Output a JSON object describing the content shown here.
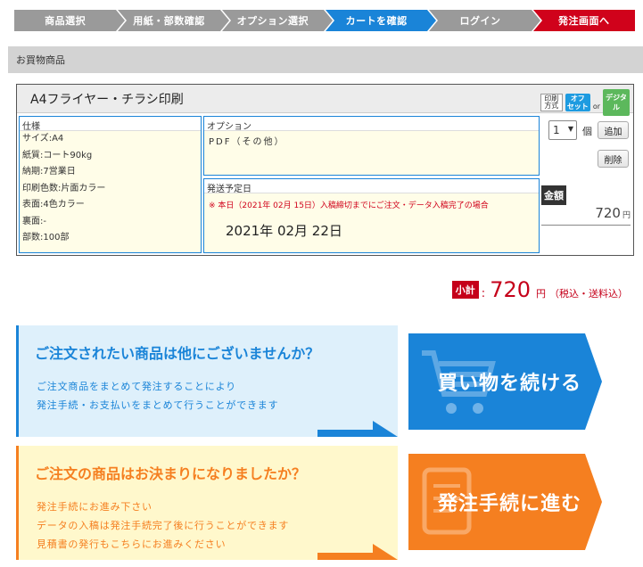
{
  "steps": [
    {
      "label": "商品選択",
      "state": "done"
    },
    {
      "label": "用紙・部数確認",
      "state": "done"
    },
    {
      "label": "オプション選択",
      "state": "done"
    },
    {
      "label": "カートを確認",
      "state": "current"
    },
    {
      "label": "ログイン",
      "state": "todo"
    },
    {
      "label": "発注画面へ",
      "state": "order"
    }
  ],
  "section_title": "お買物商品",
  "product": {
    "name": "A4フライヤー・チラシ印刷",
    "method_label": "印刷\n方式",
    "method_offset": "オフ\nセット",
    "method_or": "or",
    "method_digital": "デジタル",
    "spec_label": "仕様",
    "spec_lines": [
      "サイズ:A4",
      "紙質:コート90kg",
      "納期:7営業日",
      "印刷色数:片面カラー",
      "表面:4色カラー",
      "裏面:-",
      "部数:100部"
    ],
    "option_label": "オプション",
    "option_value": "PDF（その他）",
    "ship_label": "発送予定日",
    "ship_note": "※ 本日（2021年 02月 15日）入稿締切までにご注文・データ入稿完了の場合",
    "ship_date": "2021年 02月 22日",
    "qty_value": "1",
    "qty_unit": "個",
    "add_label": "追加",
    "delete_label": "削除",
    "price_label": "金額",
    "price_value": "720",
    "price_unit": "円"
  },
  "subtotal": {
    "label": "小計",
    "colon": ":",
    "value": "720",
    "unit": "円",
    "tax_note": "（税込・送料込）"
  },
  "banner_continue": {
    "title": "ご注文されたい商品は他にございませんか？",
    "lines": [
      "ご注文商品をまとめて発注することにより",
      "発注手続・お支払いをまとめて行うことができます"
    ],
    "button": "買い物を続ける"
  },
  "banner_checkout": {
    "title": "ご注文の商品はお決まりになりましたか？",
    "lines": [
      "発注手続にお進み下さい",
      "データの入稿は発注手続完了後に行うことができます",
      "見積書の発行もこちらにお進みください"
    ],
    "button": "発注手続に進む"
  },
  "colors": {
    "accent_blue": "#1a84d8",
    "accent_orange": "#f57f20",
    "accent_red": "#c5001a",
    "step_gray": "#9a9a9a"
  }
}
